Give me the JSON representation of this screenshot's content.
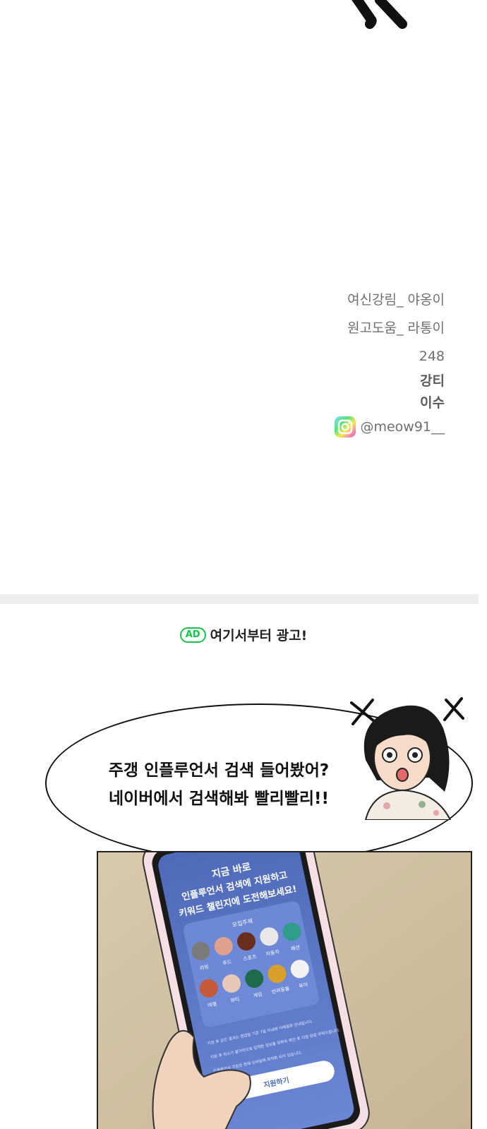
{
  "credits": {
    "line1": "여신강림_ 야옹이",
    "line2": "원고도움_ 라통이",
    "line3": "248",
    "line4": "강티",
    "line5": "이수",
    "instagram": "@meow91__"
  },
  "ad": {
    "badge": "AD",
    "header": "여기서부터 광고!",
    "bubble_line1": "주갱 인플루언서 검색 들어봤어?",
    "bubble_line2": "네이버에서 검색해봐 빨리빨리!!"
  },
  "phone": {
    "headline1": "지금 바로",
    "headline2": "인플루언서 검색에 지원하고",
    "headline3": "키워드 챌린지에 도전해보세요!",
    "section_title": "모집주제",
    "row1": [
      "리빙",
      "푸드",
      "스포츠",
      "자동차",
      "패션"
    ],
    "row2": [
      "여행",
      "뷰티",
      "게임",
      "반려동물",
      "육아"
    ],
    "notice1": "지원 후 승인 결과는 영업일 기준 7일 이내에 이메일로 안내됩니다.",
    "notice2": "지원 후 취소가 불가하므로 입력한 정보를 정확히 확인 후 지원 완료 부탁드립니다.",
    "notice3": "인플루언서 지원은 현재 모바일에 최적화 되어 있습니다.",
    "apply_button": "지원하기"
  },
  "colors": {
    "ad_green": "#17c34a",
    "phone_screen": "#5a76c4",
    "credit_text": "#6f6f6f"
  }
}
